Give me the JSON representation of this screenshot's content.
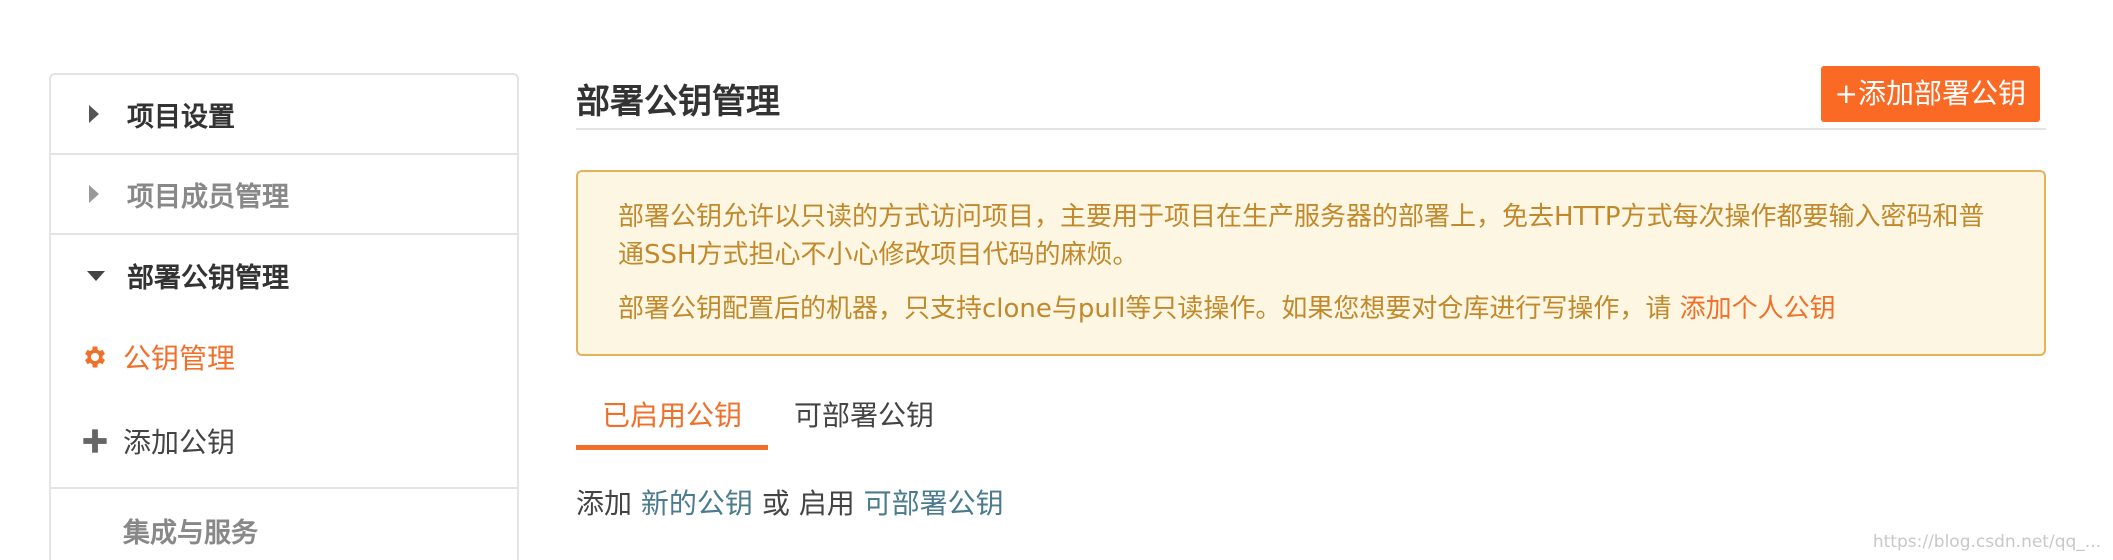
{
  "sidebar": {
    "items": [
      {
        "label": "项目设置"
      },
      {
        "label": "项目成员管理"
      },
      {
        "label": "部署公钥管理"
      }
    ],
    "sub_items": [
      {
        "label": "公钥管理",
        "icon": "gear-icon"
      },
      {
        "label": "添加公钥",
        "icon": "plus-icon"
      }
    ],
    "last_item": {
      "label": "集成与服务"
    }
  },
  "header": {
    "title": "部署公钥管理",
    "add_button": "+添加部署公钥"
  },
  "notice": {
    "line1": "部署公钥允许以只读的方式访问项目，主要用于项目在生产服务器的部署上，免去HTTP方式每次操作都要输入密码和普通SSH方式担心不小心修改项目代码的麻烦。",
    "line2_text": "部署公钥配置后的机器，只支持clone与pull等只读操作。如果您想要对仓库进行写操作，请 ",
    "line2_link": "添加个人公钥"
  },
  "tabs": [
    {
      "label": "已启用公钥",
      "active": true
    },
    {
      "label": "可部署公钥",
      "active": false
    }
  ],
  "actions": {
    "prefix": "添加 ",
    "link1": "新的公钥",
    "middle": " 或 启用 ",
    "link2": "可部署公钥"
  },
  "watermark": {
    "text": "https://blog.csdn.net/qq_..."
  },
  "colors": {
    "accent": "#fa6a25",
    "notice_bg": "#fdf6e3",
    "notice_text": "#c1892b",
    "link": "#4a7b8f"
  }
}
